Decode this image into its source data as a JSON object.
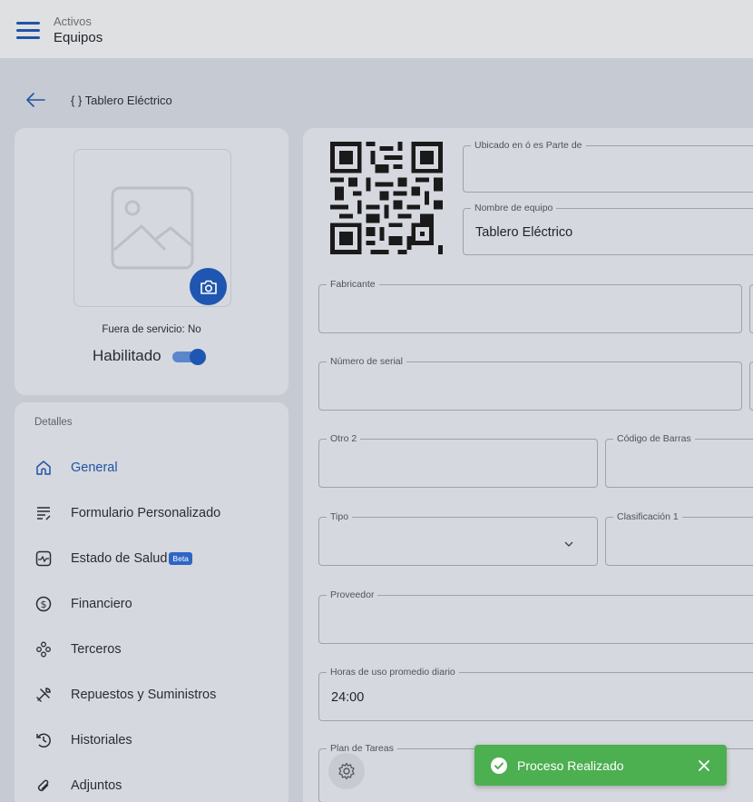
{
  "topbar": {
    "section": "Activos",
    "title": "Equipos"
  },
  "breadcrumb": {
    "text": "{ } Tablero Eléctrico"
  },
  "photo_card": {
    "fuera_de_servicio": "Fuera de servicio: No",
    "habilitado_label": "Habilitado",
    "habilitado_on": true
  },
  "details": {
    "heading": "Detalles",
    "items": [
      {
        "label": "General",
        "icon": "home-icon",
        "active": true
      },
      {
        "label": "Formulario Personalizado",
        "icon": "form-icon"
      },
      {
        "label": "Estado de Salud",
        "icon": "health-icon",
        "badge": "Beta"
      },
      {
        "label": "Financiero",
        "icon": "dollar-icon"
      },
      {
        "label": "Terceros",
        "icon": "people-icon"
      },
      {
        "label": "Repuestos y Suministros",
        "icon": "tools-icon"
      },
      {
        "label": "Historiales",
        "icon": "history-icon"
      },
      {
        "label": "Adjuntos",
        "icon": "attachment-icon"
      }
    ]
  },
  "form": {
    "ubicado": {
      "label": "Ubicado en ó es Parte de",
      "value": ""
    },
    "nombre": {
      "label": "Nombre de equipo",
      "value": "Tablero Eléctrico"
    },
    "fabricante": {
      "label": "Fabricante",
      "value": ""
    },
    "serial": {
      "label": "Número de serial",
      "value": ""
    },
    "otro2": {
      "label": "Otro 2",
      "value": ""
    },
    "codigo_barras": {
      "label": "Código de Barras",
      "value": ""
    },
    "tipo": {
      "label": "Tipo",
      "value": ""
    },
    "clasificacion1": {
      "label": "Clasificación 1",
      "value": ""
    },
    "proveedor": {
      "label": "Proveedor",
      "value": ""
    },
    "horas": {
      "label": "Horas de uso promedio diario",
      "value": "24:00"
    },
    "plan_tareas": {
      "label": "Plan de Tareas",
      "value": ""
    }
  },
  "toast": {
    "message": "Proceso Realizado",
    "color": "#4caf50"
  },
  "colors": {
    "accent": "#1f56b1"
  }
}
